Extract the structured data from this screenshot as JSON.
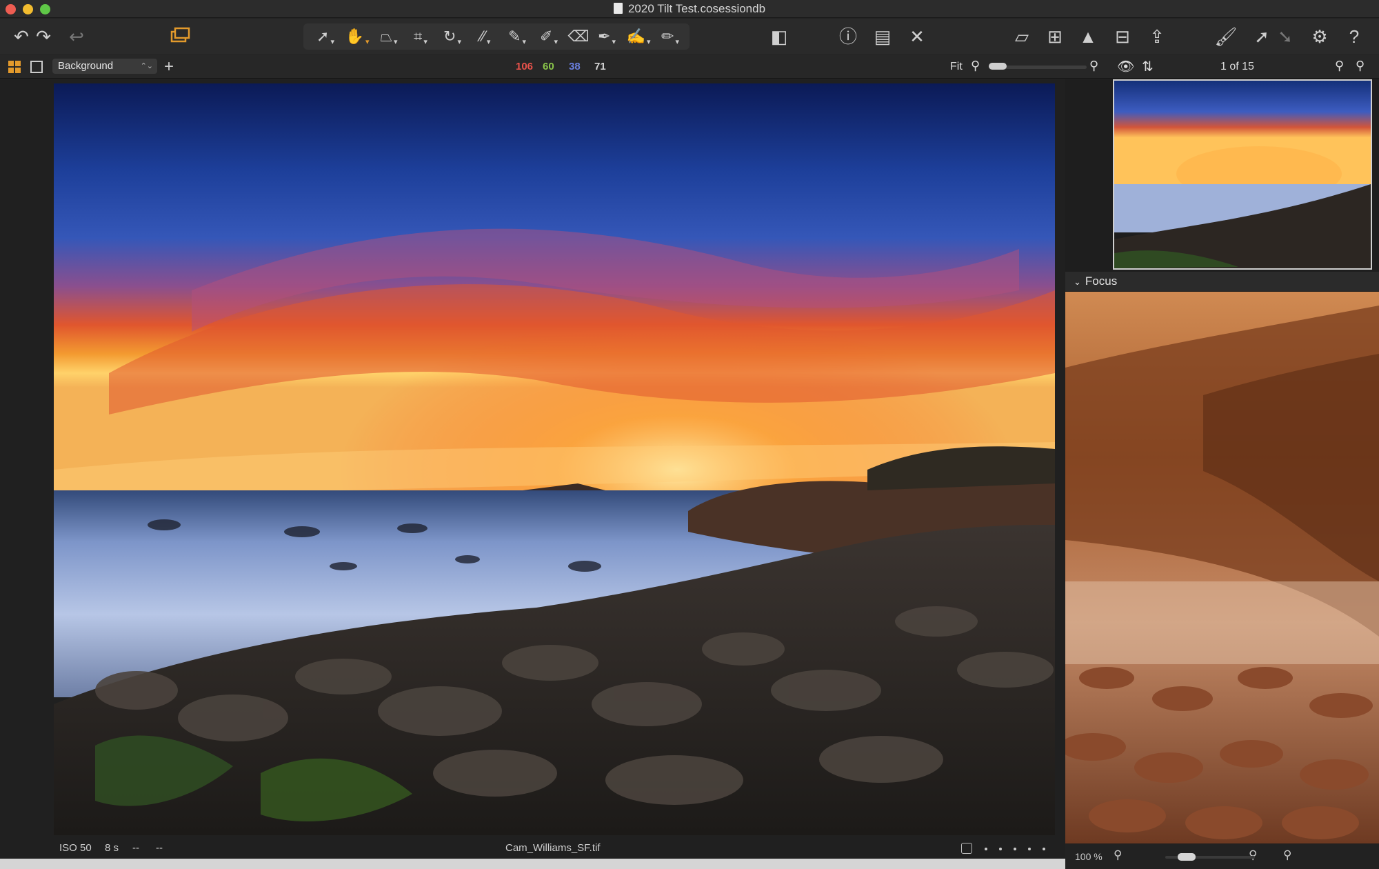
{
  "window": {
    "title": "2020 Tilt Test.cosessiondb"
  },
  "toolbar": {
    "icons": [
      "undo-icon",
      "redo-icon",
      "reset-icon",
      "variants-icon",
      "cursor-tool-icon",
      "pan-tool-icon",
      "keystone-tool-icon",
      "crop-tool-icon",
      "rotate-tool-icon",
      "straighten-tool-icon",
      "brush-tool-icon",
      "eraser-tool-icon",
      "gradient-tool-icon",
      "picker-tool-icon",
      "annotation-tool-icon",
      "compare-icon",
      "info-icon",
      "browser-toggle-icon",
      "tools-icon",
      "edit-icon",
      "grid-view-icon",
      "exposure-warning-icon",
      "grid-overlay-icon",
      "export-icon",
      "brush-icon",
      "arrow-icon",
      "settings-icon",
      "help-icon"
    ]
  },
  "subbar": {
    "layer": "Background",
    "rgb": {
      "r": "106",
      "g": "60",
      "b": "38",
      "l": "71"
    },
    "colors": {
      "r": "#e8524b",
      "g": "#8ac64a",
      "b": "#6a7fe0",
      "l": "#d8d8d8"
    },
    "zoom_label": "Fit",
    "counter": "1 of 15"
  },
  "info": {
    "iso": "ISO 50",
    "shutter": "8 s",
    "aperture": "--",
    "focal": "--",
    "filename": "Cam_Williams_SF.tif"
  },
  "focus": {
    "title": "Focus",
    "zoom": "100 %"
  }
}
